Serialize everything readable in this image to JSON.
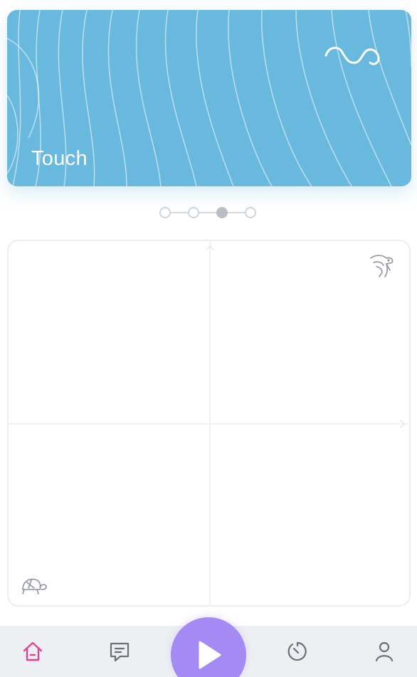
{
  "mode_card": {
    "mode_name": "Touch",
    "background_color": "#69b9df",
    "logo_icon": "wave-logo-icon"
  },
  "carousel": {
    "page_count": 4,
    "active_index": 2
  },
  "control_pad": {
    "fast_icon": "rabbit-icon",
    "slow_icon": "turtle-icon"
  },
  "bottom_nav": {
    "items": [
      {
        "icon": "home-icon",
        "active": true
      },
      {
        "icon": "chat-icon",
        "active": false
      },
      {
        "icon": "play-icon",
        "active": false
      },
      {
        "icon": "timer-icon",
        "active": false
      },
      {
        "icon": "profile-icon",
        "active": false
      }
    ],
    "active_color": "#e0458f",
    "inactive_color": "#6e7079",
    "play_color": "#a58af3"
  }
}
